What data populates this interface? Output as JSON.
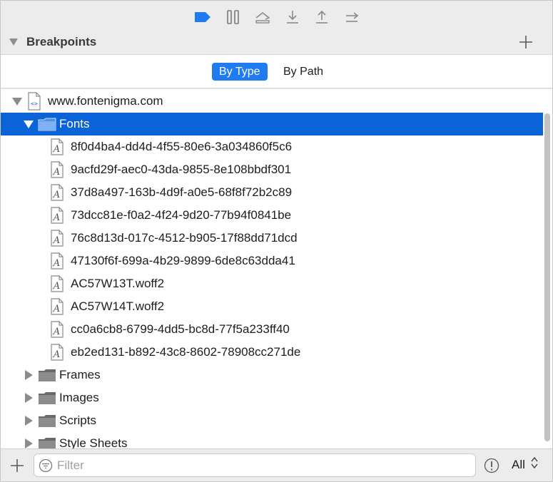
{
  "toolbar": {
    "buttons": [
      {
        "name": "breakpoints-toggle-icon"
      },
      {
        "name": "pause-icon"
      },
      {
        "name": "step-over-icon"
      },
      {
        "name": "step-into-icon"
      },
      {
        "name": "step-out-icon"
      },
      {
        "name": "step-icon"
      }
    ],
    "accent_color": "#1f7bf2"
  },
  "section": {
    "title": "Breakpoints"
  },
  "segmented": {
    "by_type": "By Type",
    "by_path": "By Path",
    "selected": "By Type"
  },
  "tree": {
    "root": "www.fontenigma.com",
    "folder_fonts": "Fonts",
    "fonts": [
      "8f0d4ba4-dd4d-4f55-80e6-3a034860f5c6",
      "9acfd29f-aec0-43da-9855-8e108bbdf301",
      "37d8a497-163b-4d9f-a0e5-68f8f72b2c89",
      "73dcc81e-f0a2-4f24-9d20-77b94f0841be",
      "76c8d13d-017c-4512-b905-17f88dd71dcd",
      "47130f6f-699a-4b29-9899-6de8c63dda41",
      "AC57W13T.woff2",
      "AC57W14T.woff2",
      "cc0a6cb8-6799-4dd5-bc8d-77f5a233ff40",
      "eb2ed131-b892-43c8-8602-78908cc271de"
    ],
    "folders": [
      "Frames",
      "Images",
      "Scripts",
      "Style Sheets"
    ],
    "selection_color": "#0a64d7"
  },
  "filter": {
    "placeholder": "Filter",
    "value": "",
    "scope": "All"
  }
}
